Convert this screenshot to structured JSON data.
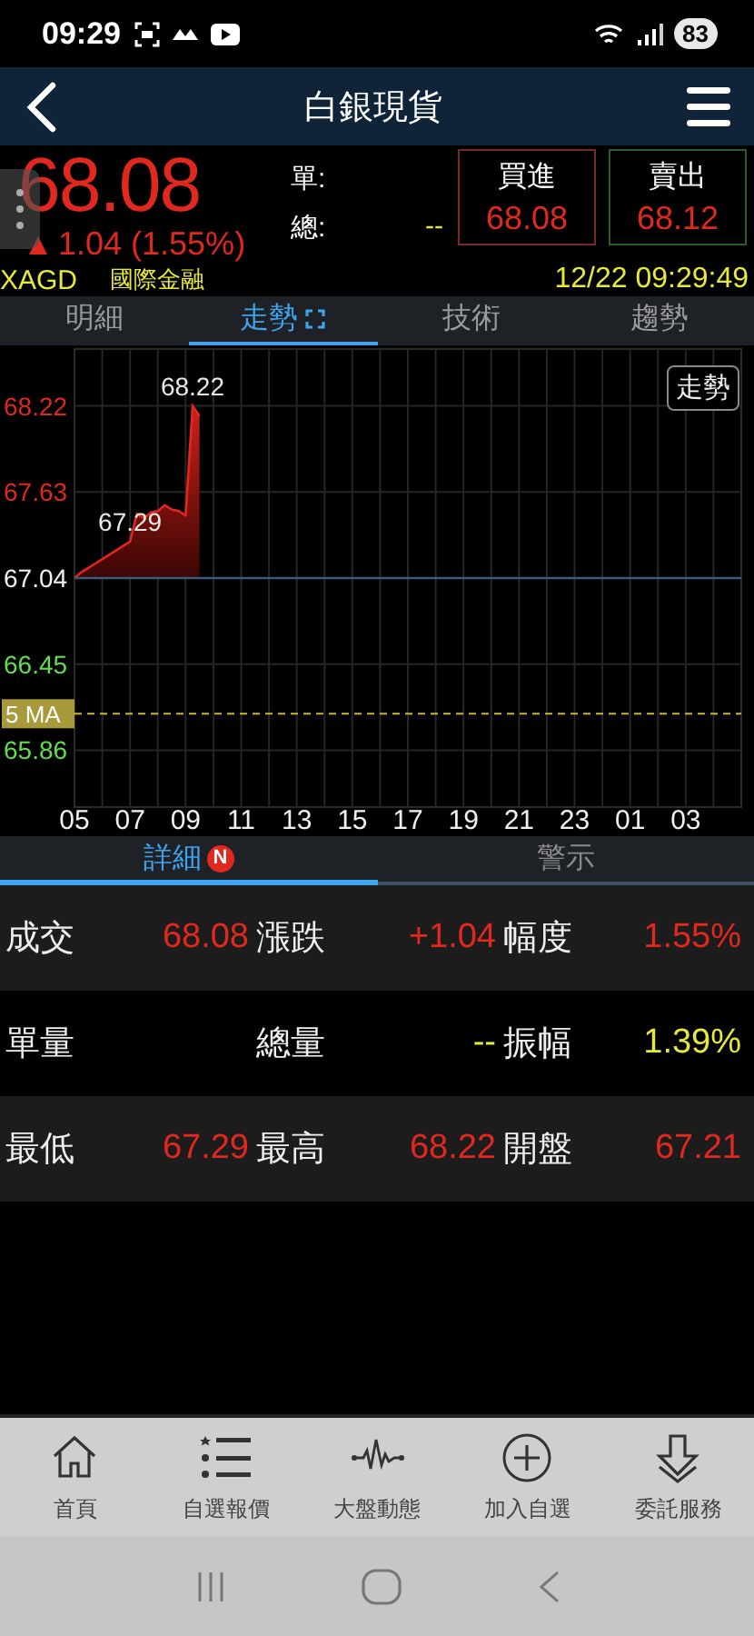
{
  "status_bar": {
    "time": "09:29",
    "battery": "83"
  },
  "header": {
    "title": "白銀現貨"
  },
  "quote": {
    "price": "68.08",
    "up": true,
    "change": "1.04",
    "change_pct": "(1.55%)",
    "single_label": "單:",
    "total_label": "總:",
    "total_value": "--",
    "buy": {
      "label": "買進",
      "value": "68.08"
    },
    "sell": {
      "label": "賣出",
      "value": "68.12"
    }
  },
  "info": {
    "code": "XAGD",
    "market": "國際金融",
    "datetime": "12/22 09:29:49"
  },
  "tabs": [
    {
      "label": "明細",
      "selected": false
    },
    {
      "label": "走勢",
      "selected": true
    },
    {
      "label": "技術",
      "selected": false
    },
    {
      "label": "趨勢",
      "selected": false
    }
  ],
  "chart": {
    "mode_button": "走勢",
    "chart_data": {
      "type": "line",
      "grid": true,
      "categories": [
        "05",
        null,
        null,
        null,
        null,
        null,
        null,
        null,
        "07",
        null,
        null,
        null,
        null,
        null,
        null,
        null,
        "09",
        null,
        null,
        null,
        null,
        null,
        null,
        null,
        "11",
        null,
        null,
        null,
        null,
        null,
        null,
        null,
        "13",
        null,
        null,
        null,
        null,
        null,
        null,
        null,
        "15",
        null,
        null,
        null,
        null,
        null,
        null,
        null,
        "17",
        null,
        null,
        null,
        null,
        null,
        null,
        null,
        "19",
        null,
        null,
        null,
        null,
        null,
        null,
        null,
        "21",
        null,
        null,
        null,
        null,
        null,
        null,
        null,
        "23",
        null,
        null,
        null,
        null,
        null,
        null,
        null,
        "01",
        null,
        null,
        null,
        null,
        null,
        null,
        null,
        "03",
        null,
        null,
        null,
        null,
        null,
        null,
        null
      ],
      "series": [
        {
          "color": "#e0281e",
          "values": [
            67.04,
            67.08,
            67.11,
            67.14,
            67.17,
            67.2,
            67.23,
            67.26,
            67.29,
            67.48,
            67.45,
            67.49,
            67.5,
            67.54,
            67.51,
            67.5,
            67.47,
            68.22,
            68.15,
            null,
            null,
            null,
            null,
            null,
            null,
            null,
            null,
            null,
            null,
            null,
            null,
            null,
            null,
            null,
            null,
            null,
            null,
            null,
            null,
            null,
            null,
            null,
            null,
            null,
            null,
            null,
            null,
            null,
            null,
            null,
            null,
            null,
            null,
            null,
            null,
            null,
            null,
            null,
            null,
            null,
            null,
            null,
            null,
            null,
            null,
            null,
            null,
            null,
            null,
            null,
            null,
            null,
            null,
            null,
            null,
            null,
            null,
            null,
            null,
            null,
            null,
            null,
            null,
            null,
            null,
            null,
            null,
            null,
            null,
            null,
            null,
            null,
            null,
            null,
            null,
            null
          ]
        }
      ],
      "ylim": [
        65.47,
        68.61
      ],
      "yticks": [
        {
          "value": 68.22,
          "label": "68.22"
        },
        {
          "value": 67.63,
          "label": "67.63"
        },
        {
          "value": 67.04,
          "label": "67.04"
        },
        {
          "value": 66.45,
          "label": "66.45"
        },
        {
          "value": 65.86,
          "label": "65.86"
        }
      ],
      "annotations": [
        {
          "y": 68.22,
          "text": "68.22"
        },
        {
          "y": 67.29,
          "text": "67.29"
        }
      ],
      "ref_lines": [
        {
          "axis": "y",
          "value": 67.04
        },
        {
          "axis": "y",
          "value": 66.11,
          "label": "5 MA"
        }
      ]
    }
  },
  "detail_tabs": [
    {
      "label": "詳細",
      "badge": "N",
      "selected": true
    },
    {
      "label": "警示",
      "selected": false
    }
  ],
  "stats": [
    [
      {
        "label": "成交",
        "value": "68.08",
        "color": "#e0281e"
      },
      {
        "label": "漲跌",
        "value": "+1.04",
        "color": "#e0281e"
      },
      {
        "label": "幅度",
        "value": "1.55%",
        "color": "#e0281e"
      }
    ],
    [
      {
        "label": "單量"
      },
      {
        "label": "總量",
        "value": "--",
        "color": "#e8e83a"
      },
      {
        "label": "振幅",
        "value": "1.39%",
        "color": "#e8e83a"
      }
    ],
    [
      {
        "label": "最低",
        "value": "67.29",
        "color": "#e0281e"
      },
      {
        "label": "最高",
        "value": "68.22",
        "color": "#e0281e"
      },
      {
        "label": "開盤",
        "value": "67.21",
        "color": "#e0281e"
      }
    ]
  ],
  "bottom_nav": [
    {
      "kind": "home",
      "label": "首頁"
    },
    {
      "kind": "list",
      "label": "自選報價"
    },
    {
      "kind": "pulse",
      "label": "大盤動態"
    },
    {
      "kind": "add",
      "label": "加入自選"
    },
    {
      "kind": "download",
      "label": "委託服務"
    }
  ]
}
